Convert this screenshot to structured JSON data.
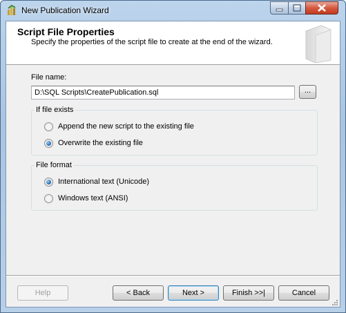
{
  "window": {
    "title": "New Publication Wizard"
  },
  "header": {
    "title": "Script File Properties",
    "subtitle": "Specify the properties of the script file to create at the end of the wizard."
  },
  "file_name": {
    "label": "File name:",
    "value": "D:\\SQL Scripts\\CreatePublication.sql",
    "browse_label": "..."
  },
  "if_file_exists": {
    "title": "If file exists",
    "options": [
      {
        "label": "Append the new script to the existing file",
        "checked": false
      },
      {
        "label": "Overwrite the existing file",
        "checked": true
      }
    ]
  },
  "file_format": {
    "title": "File format",
    "options": [
      {
        "label": "International text (Unicode)",
        "checked": true
      },
      {
        "label": "Windows text (ANSI)",
        "checked": false
      }
    ]
  },
  "buttons": {
    "help": "Help",
    "back": "< Back",
    "next": "Next >",
    "finish": "Finish >>|",
    "cancel": "Cancel"
  }
}
